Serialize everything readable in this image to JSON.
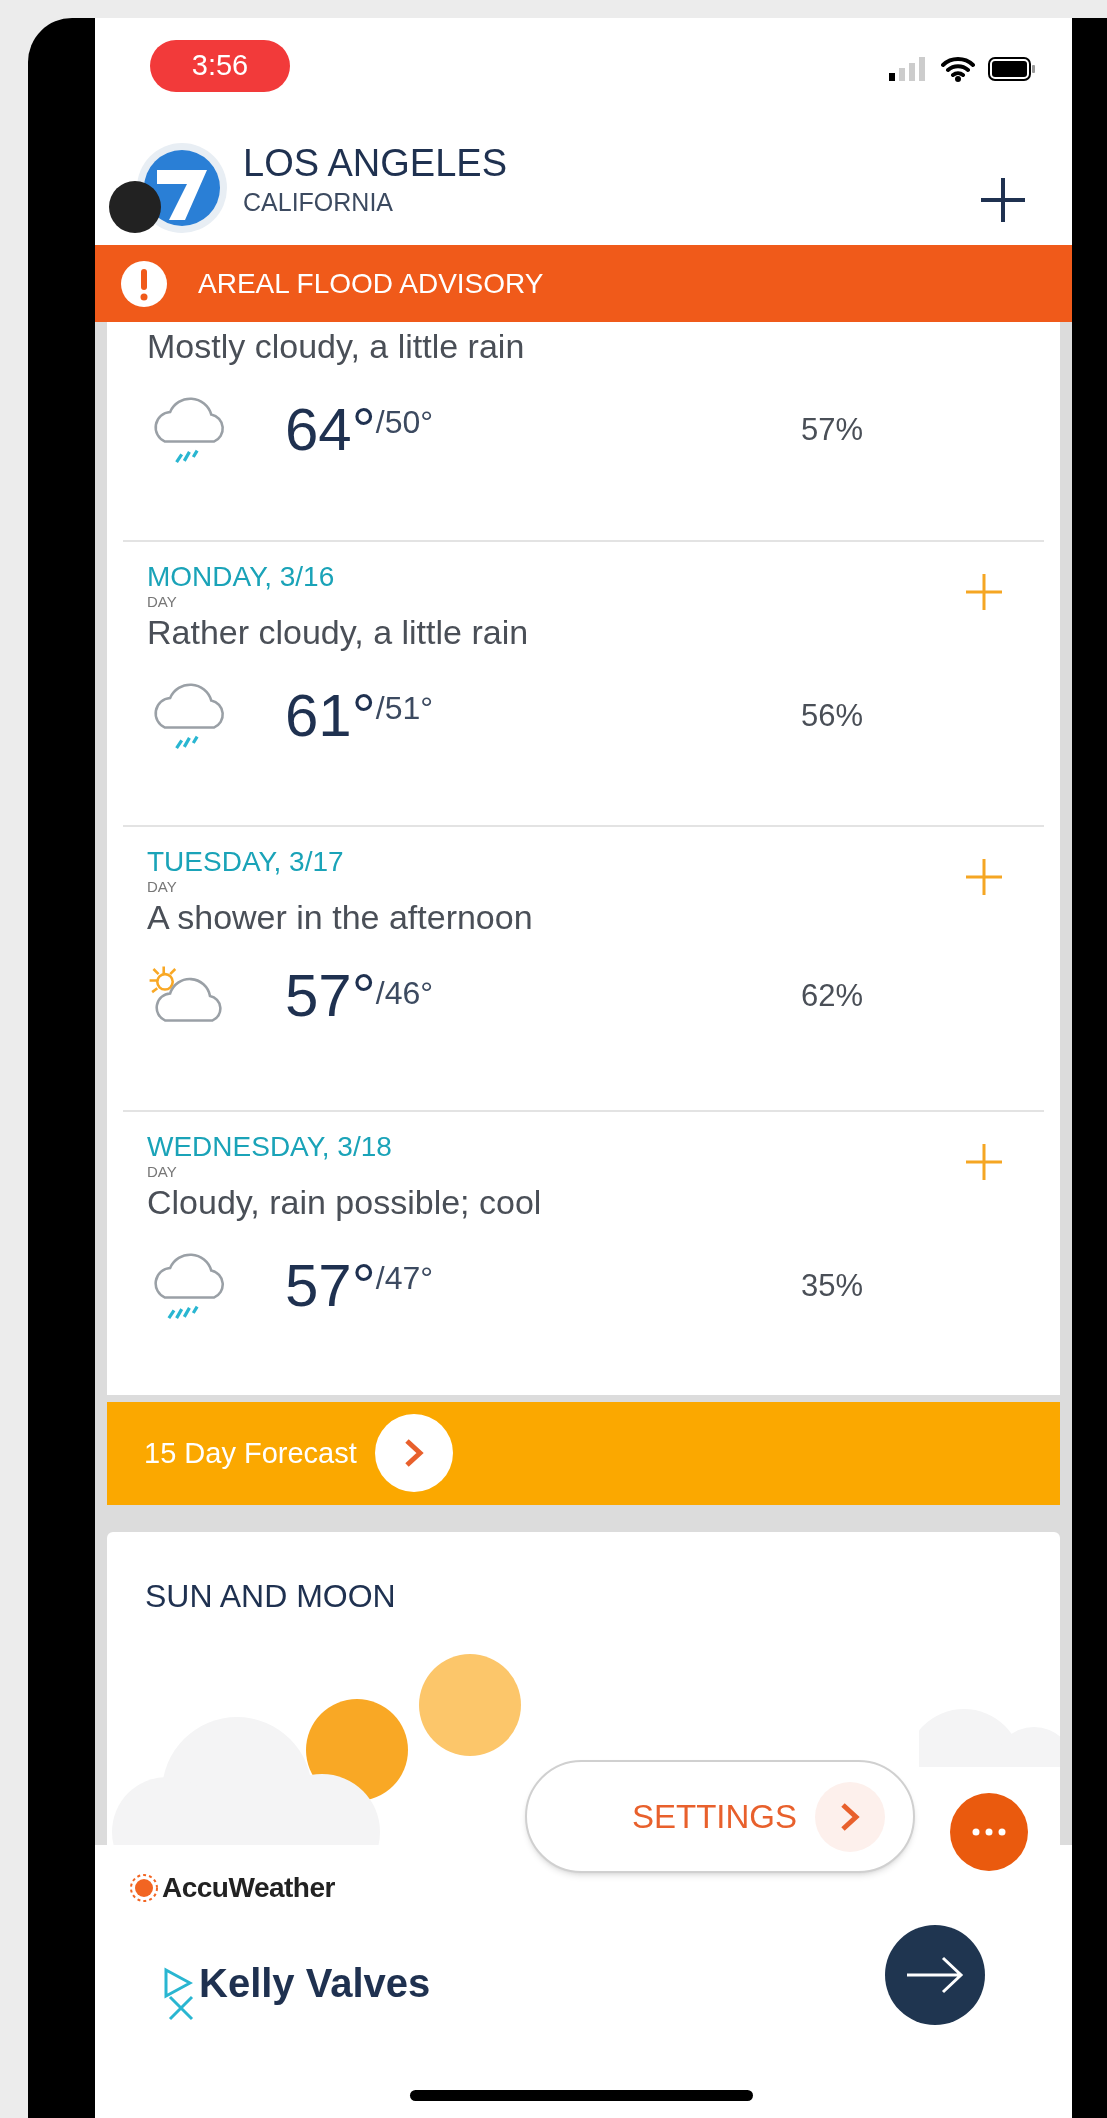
{
  "status_bar": {
    "time": "3:56"
  },
  "header": {
    "city": "LOS ANGELES",
    "region": "CALIFORNIA"
  },
  "alert": {
    "text": "AREAL FLOOD ADVISORY"
  },
  "forecast": [
    {
      "summary": "Mostly cloudy, a little rain",
      "kind": "rain",
      "high": "64°",
      "low": "/50°",
      "precip": "57%"
    },
    {
      "date": "MONDAY, 3/16",
      "period": "DAY",
      "expanded": false,
      "summary": "Rather cloudy, a little rain",
      "kind": "rain",
      "high": "61°",
      "low": "/51°",
      "precip": "56%"
    },
    {
      "date": "TUESDAY, 3/17",
      "period": "DAY",
      "expanded": false,
      "summary": "A shower in the afternoon",
      "kind": "partly-sunny",
      "high": "57°",
      "low": "/46°",
      "precip": "62%"
    },
    {
      "date": "WEDNESDAY, 3/18",
      "period": "DAY",
      "expanded": false,
      "summary": "Cloudy, rain possible; cool",
      "kind": "heavy-rain",
      "high": "57°",
      "low": "/47°",
      "precip": "35%"
    }
  ],
  "forecast_button": {
    "label": "15 Day Forecast"
  },
  "sun_and_moon": {
    "title": "SUN AND MOON"
  },
  "settings_button": {
    "label": "SETTINGS"
  },
  "ad": {
    "brand": "AccuWeather",
    "advertiser": "Kelly Valves"
  }
}
